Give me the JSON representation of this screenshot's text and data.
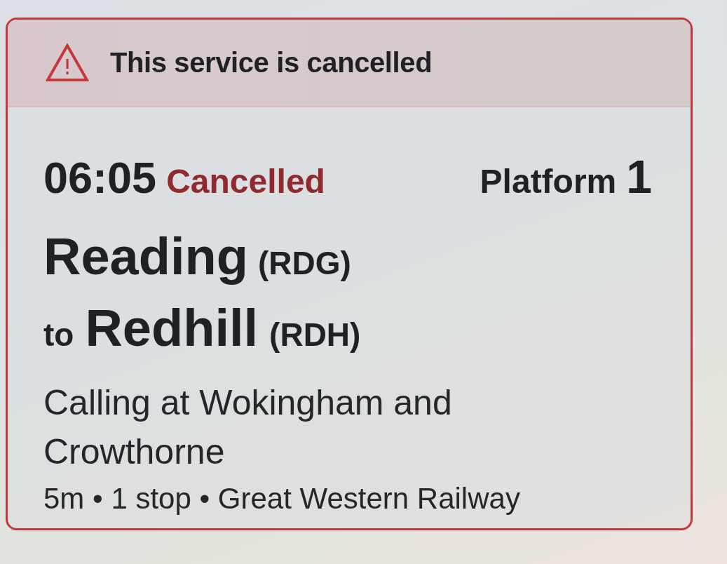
{
  "alert": {
    "kind": "warning",
    "message": "This service is cancelled"
  },
  "service": {
    "time": "06:05",
    "status": "Cancelled",
    "cancelled": true,
    "platform_label": "Platform",
    "platform_number": "1",
    "origin": {
      "name": "Reading",
      "code": "(RDG)"
    },
    "connector": "to",
    "destination": {
      "name": "Redhill",
      "code": "(RDH)"
    },
    "calling_at": "Calling at Wokingham and Crowthorne",
    "details": "5m • 1 stop • Great Western Railway"
  }
}
